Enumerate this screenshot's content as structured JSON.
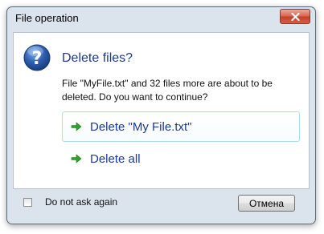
{
  "window": {
    "title": "File operation"
  },
  "dialog": {
    "heading": "Delete files?",
    "message": "File \"MyFile.txt\" and 32 files more are about to be deleted. Do you want to continue?",
    "commands": [
      {
        "label": "Delete \"My File.txt\"",
        "icon": "green-arrow-icon",
        "selected": true
      },
      {
        "label": "Delete all",
        "icon": "green-arrow-icon",
        "selected": false
      }
    ]
  },
  "footer": {
    "checkbox_label": "Do not ask again",
    "checkbox_checked": false,
    "cancel_label": "Отмена"
  },
  "colors": {
    "heading": "#1e3a8a",
    "command_text": "#1c3a8e",
    "arrow_green": "#2aa52a",
    "question_icon_blue": "#2f5fb0"
  },
  "icons": {
    "dialog": "question-icon",
    "close": "close-icon"
  }
}
